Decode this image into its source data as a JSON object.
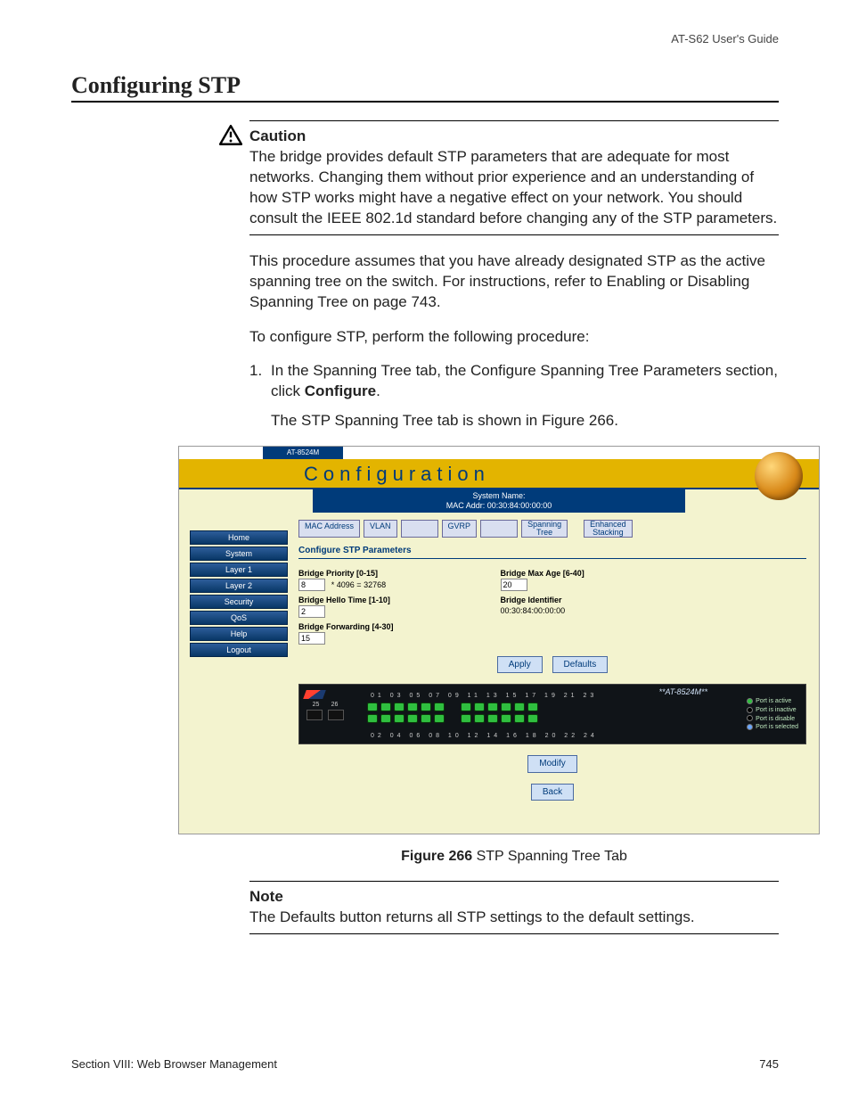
{
  "header": {
    "guide": "AT-S62 User's Guide"
  },
  "title": "Configuring STP",
  "caution": {
    "label": "Caution",
    "body": "The bridge provides default STP parameters that are adequate for most networks. Changing them without prior experience and an understanding of how STP works might have a negative effect on your network. You should consult the IEEE 802.1d standard before changing any of the STP parameters."
  },
  "para1": "This procedure assumes that you have already designated STP as the active spanning tree on the switch. For instructions, refer to Enabling or Disabling Spanning Tree on page 743.",
  "para2": "To configure STP, perform the following procedure:",
  "step1": {
    "num": "1.",
    "text_a": "In the Spanning Tree tab, the Configure Spanning Tree Parameters section, click ",
    "text_b": "Configure",
    "text_c": "."
  },
  "step1_result": "The STP Spanning Tree tab is shown in Figure 266.",
  "figure": {
    "caption_bold": "Figure 266",
    "caption_rest": "  STP Spanning Tree Tab"
  },
  "note": {
    "label": "Note",
    "body": "The Defaults button returns all STP settings to the default settings."
  },
  "footer": {
    "section": "Section VIII: Web Browser Management",
    "pagenum": "745"
  },
  "shot": {
    "device_tab": "AT-8524M",
    "banner": "Configuration",
    "sysname_label": "System Name:",
    "mac_label": "MAC Addr: 00:30:84:00:00:00",
    "nav": [
      "Home",
      "System",
      "Layer 1",
      "Layer 2",
      "Security",
      "QoS",
      "Help",
      "Logout"
    ],
    "tabs": {
      "mac": "MAC Address",
      "vlan": "VLAN",
      "gvrp": "GVRP",
      "st1": "Spanning",
      "st2": "Tree",
      "es1": "Enhanced",
      "es2": "Stacking"
    },
    "section": "Configure STP Parameters",
    "fields": {
      "bp_label": "Bridge Priority [0-15]",
      "bp_value": "8",
      "bp_mult": "* 4096 = 32768",
      "bht_label": "Bridge Hello Time [1-10]",
      "bht_value": "2",
      "bf_label": "Bridge Forwarding [4-30]",
      "bf_value": "15",
      "bma_label": "Bridge Max Age [6-40]",
      "bma_value": "20",
      "bid_label": "Bridge Identifier",
      "bid_value": "00:30:84:00:00:00"
    },
    "buttons": {
      "apply": "Apply",
      "defaults": "Defaults",
      "modify": "Modify",
      "back": "Back"
    },
    "switch": {
      "model": "**AT-8524M**",
      "top_nums": "01  03  05  07  09  11     13  15  17  19  21  23",
      "bot_nums": "02  04  06  08  10  12     14  16  18  20  22  24",
      "sfp_a": "25",
      "sfp_b": "26",
      "leg_active": "Port is active",
      "leg_inactive": "Port is inactive",
      "leg_disable": "Port is disable",
      "leg_selected": "Port is selected"
    }
  }
}
